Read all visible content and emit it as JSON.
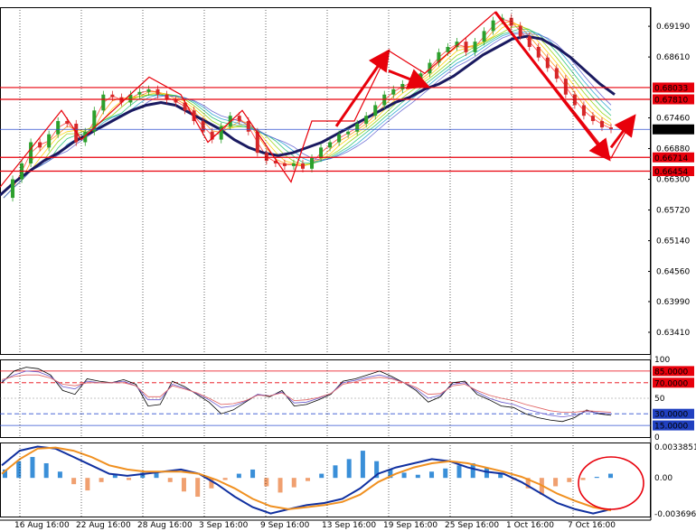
{
  "chart_data": [
    {
      "type": "candlestick",
      "panel": "price",
      "ylim": [
        0.63,
        0.6955
      ],
      "y_ticks": [
        "0.69190",
        "0.68610",
        "0.68033",
        "0.67810",
        "0.67460",
        "0.67243",
        "0.66880",
        "0.66714",
        "0.66454",
        "0.66300",
        "0.65720",
        "0.65140",
        "0.64560",
        "0.63990",
        "0.63410"
      ],
      "levels": [
        {
          "label": "0.68033",
          "value": 0.68033,
          "color": "#e8000b"
        },
        {
          "label": "0.67810",
          "value": 0.6781,
          "color": "#e8000b"
        },
        {
          "label": "0.66714",
          "value": 0.66714,
          "color": "#e8000b"
        },
        {
          "label": "0.66454",
          "value": 0.66454,
          "color": "#e8000b"
        },
        {
          "label": "0.67243",
          "value": 0.67243,
          "color": "#3050d0"
        }
      ],
      "current_price": "0.67243",
      "price_path": [
        0.6595,
        0.663,
        0.666,
        0.67,
        0.669,
        0.6715,
        0.674,
        0.6735,
        0.67,
        0.672,
        0.676,
        0.679,
        0.6785,
        0.6775,
        0.679,
        0.6795,
        0.68,
        0.679,
        0.678,
        0.6775,
        0.676,
        0.674,
        0.672,
        0.6705,
        0.673,
        0.675,
        0.674,
        0.672,
        0.668,
        0.6665,
        0.666,
        0.6655,
        0.666,
        0.665,
        0.667,
        0.669,
        0.67,
        0.6715,
        0.672,
        0.6735,
        0.675,
        0.677,
        0.679,
        0.68,
        0.681,
        0.6815,
        0.683,
        0.685,
        0.687,
        0.688,
        0.689,
        0.687,
        0.689,
        0.691,
        0.693,
        0.6935,
        0.692,
        0.69,
        0.688,
        0.686,
        0.684,
        0.682,
        0.679,
        0.677,
        0.675,
        0.674,
        0.6728,
        0.6724
      ],
      "ma_slow": [
        0.66,
        0.6625,
        0.6645,
        0.6665,
        0.668,
        0.67,
        0.6715,
        0.673,
        0.6745,
        0.676,
        0.677,
        0.6775,
        0.677,
        0.6755,
        0.674,
        0.6725,
        0.6705,
        0.669,
        0.668,
        0.6675,
        0.668,
        0.669,
        0.67,
        0.6715,
        0.673,
        0.6745,
        0.676,
        0.6775,
        0.6785,
        0.68,
        0.681,
        0.6825,
        0.6845,
        0.6865,
        0.688,
        0.6895,
        0.69,
        0.6895,
        0.688,
        0.686,
        0.6835,
        0.681,
        0.679
      ],
      "annotation_arrows": [
        {
          "from": [
            0.6693,
            0.6682
          ],
          "to": [
            0.673,
            0.6762
          ]
        },
        {
          "from": [
            0.6762,
            0.6745
          ],
          "to": [
            0.6718,
            0.6722
          ]
        },
        {
          "from": [
            0.673,
            0.683
          ],
          "to": [
            0.687,
            0.6873
          ]
        },
        {
          "from": [
            0.68,
            0.6805
          ],
          "to": [
            0.687,
            0.683
          ]
        },
        {
          "from": [
            0.6893,
            0.6943
          ],
          "to": [
            0.672,
            0.667
          ]
        },
        {
          "from": [
            0.667,
            0.67
          ],
          "to": [
            0.668,
            0.675
          ]
        }
      ]
    },
    {
      "type": "line",
      "panel": "oscillator",
      "ylim": [
        0,
        100
      ],
      "y_ticks": [
        "100",
        "50",
        "0"
      ],
      "levels": [
        {
          "label": "85.0000",
          "value": 85,
          "color": "#e8000b",
          "style": "solid"
        },
        {
          "label": "70.0000",
          "value": 70,
          "color": "#e8000b",
          "style": "dashed"
        },
        {
          "label": "30.0000",
          "value": 30,
          "color": "#3050d0",
          "style": "dashed"
        },
        {
          "label": "15.0000",
          "value": 15,
          "color": "#3050d0",
          "style": "solid"
        }
      ],
      "series": [
        {
          "color": "#000000",
          "values": [
            70,
            85,
            90,
            88,
            80,
            60,
            55,
            75,
            72,
            70,
            74,
            68,
            40,
            42,
            72,
            65,
            55,
            45,
            30,
            35,
            45,
            55,
            52,
            60,
            40,
            42,
            48,
            55,
            72,
            75,
            80,
            85,
            78,
            70,
            60,
            45,
            52,
            70,
            72,
            55,
            48,
            40,
            38,
            30,
            25,
            22,
            20,
            25,
            35,
            30,
            28
          ]
        },
        {
          "color": "#6a5acd",
          "values": [
            72,
            80,
            85,
            84,
            78,
            65,
            62,
            72,
            70,
            70,
            72,
            66,
            48,
            48,
            68,
            63,
            56,
            48,
            38,
            40,
            46,
            55,
            53,
            58,
            44,
            45,
            50,
            56,
            70,
            73,
            77,
            80,
            76,
            70,
            62,
            50,
            54,
            68,
            70,
            58,
            50,
            45,
            42,
            36,
            32,
            28,
            26,
            28,
            33,
            31,
            30
          ]
        },
        {
          "color": "#e06060",
          "values": [
            74,
            78,
            80,
            80,
            76,
            68,
            66,
            70,
            70,
            70,
            70,
            66,
            52,
            52,
            66,
            62,
            57,
            50,
            42,
            43,
            47,
            54,
            53,
            57,
            47,
            48,
            51,
            56,
            68,
            71,
            75,
            77,
            75,
            70,
            64,
            55,
            56,
            66,
            68,
            60,
            54,
            50,
            47,
            42,
            38,
            34,
            32,
            32,
            34,
            33,
            32
          ]
        }
      ]
    },
    {
      "type": "histogram",
      "panel": "macd",
      "ylim": [
        -0.0036963,
        0.0033851
      ],
      "y_ticks": [
        "0.0033851",
        "0.00",
        "-0.0036963"
      ],
      "histogram": [
        0.0008,
        0.0016,
        0.002,
        0.0014,
        0.0006,
        -0.0006,
        -0.0012,
        -0.0004,
        0.0004,
        -0.0002,
        0.0005,
        0.0006,
        -0.0004,
        -0.0013,
        -0.0018,
        -0.001,
        -0.0002,
        0.0004,
        0.0008,
        -0.0008,
        -0.0014,
        -0.0009,
        -0.0003,
        0.0004,
        0.0012,
        0.0018,
        0.0026,
        0.0016,
        0.0008,
        0.0005,
        0.0003,
        0.0006,
        0.0009,
        0.0012,
        0.0014,
        0.001,
        0.0005,
        -0.0002,
        -0.001,
        -0.0016,
        -0.0008,
        -0.0004,
        -0.0002,
        0.0001,
        0.0004
      ],
      "series": [
        {
          "color": "#1030a0",
          "values": [
            0.0012,
            0.0026,
            0.003,
            0.0028,
            0.002,
            0.0012,
            0.0004,
            0.0002,
            0.0004,
            0.0006,
            0.0008,
            0.0004,
            -0.0006,
            -0.0018,
            -0.0028,
            -0.0034,
            -0.003,
            -0.0026,
            -0.0024,
            -0.002,
            -0.001,
            0.0004,
            0.001,
            0.0014,
            0.0018,
            0.0016,
            0.001,
            0.0006,
            0.0004,
            -0.0004,
            -0.0014,
            -0.0024,
            -0.003,
            -0.0034,
            -0.003
          ]
        },
        {
          "color": "#f09020",
          "values": [
            0.0004,
            0.0018,
            0.0028,
            0.0029,
            0.0026,
            0.002,
            0.0012,
            0.0008,
            0.0006,
            0.0006,
            0.0006,
            0.0004,
            -0.0002,
            -0.001,
            -0.002,
            -0.0027,
            -0.003,
            -0.0028,
            -0.0026,
            -0.0023,
            -0.0016,
            -0.0004,
            0.0004,
            0.001,
            0.0014,
            0.0016,
            0.0014,
            0.001,
            0.0006,
            0.0001,
            -0.0006,
            -0.0015,
            -0.0022,
            -0.0028,
            -0.0031
          ]
        }
      ]
    }
  ],
  "x_axis": {
    "labels": [
      "16 Aug 16:00",
      "22 Aug 16:00",
      "28 Aug 16:00",
      "3 Sep 16:00",
      "9 Sep 16:00",
      "13 Sep 16:00",
      "19 Sep 16:00",
      "25 Sep 16:00",
      "1 Oct 16:00",
      "7 Oct 16:00"
    ]
  },
  "colors": {
    "up": "#2ca02c",
    "down": "#d62728",
    "grid": "#000000",
    "annotation": "#e8000b",
    "level_bg": "#e8000b",
    "current_bg": "#000000",
    "blue_level_bg": "#2040c0",
    "hist_pos": "#3a8fd8",
    "hist_neg": "#f0a070",
    "ribbon": [
      "#ff3030",
      "#ff8c00",
      "#ffd000",
      "#8fd000",
      "#20c070",
      "#20a0d0",
      "#6060d0"
    ]
  }
}
